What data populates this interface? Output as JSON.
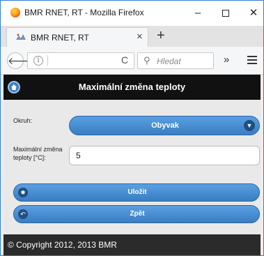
{
  "window": {
    "title": "BMR RNET, RT - Mozilla Firefox",
    "icon": "firefox-icon",
    "controls": {
      "minimize": "–",
      "close": "✕"
    }
  },
  "tabs": [
    {
      "title": "BMR RNET, RT",
      "icon": "site-favicon"
    }
  ],
  "new_tab_label": "+",
  "navbar": {
    "url": "",
    "search_placeholder": "Hledat",
    "back_icon": "back-arrow-icon",
    "reload_icon": "reload-icon",
    "overflow_label": "»"
  },
  "page": {
    "header_title": "Maximální změna teploty",
    "form": {
      "circuit_label": "Okruh:",
      "circuit_value": "Obyvak",
      "max_change_label": "Maximální změna teploty [°C]:",
      "max_change_value": "5"
    },
    "buttons": {
      "save": "Uložit",
      "back": "Zpět"
    },
    "footer": "© Copyright 2012, 2013 BMR"
  },
  "colors": {
    "button_blue": "#3a7dc2",
    "header_bg": "#111111",
    "footer_bg": "#2b2b2b"
  }
}
